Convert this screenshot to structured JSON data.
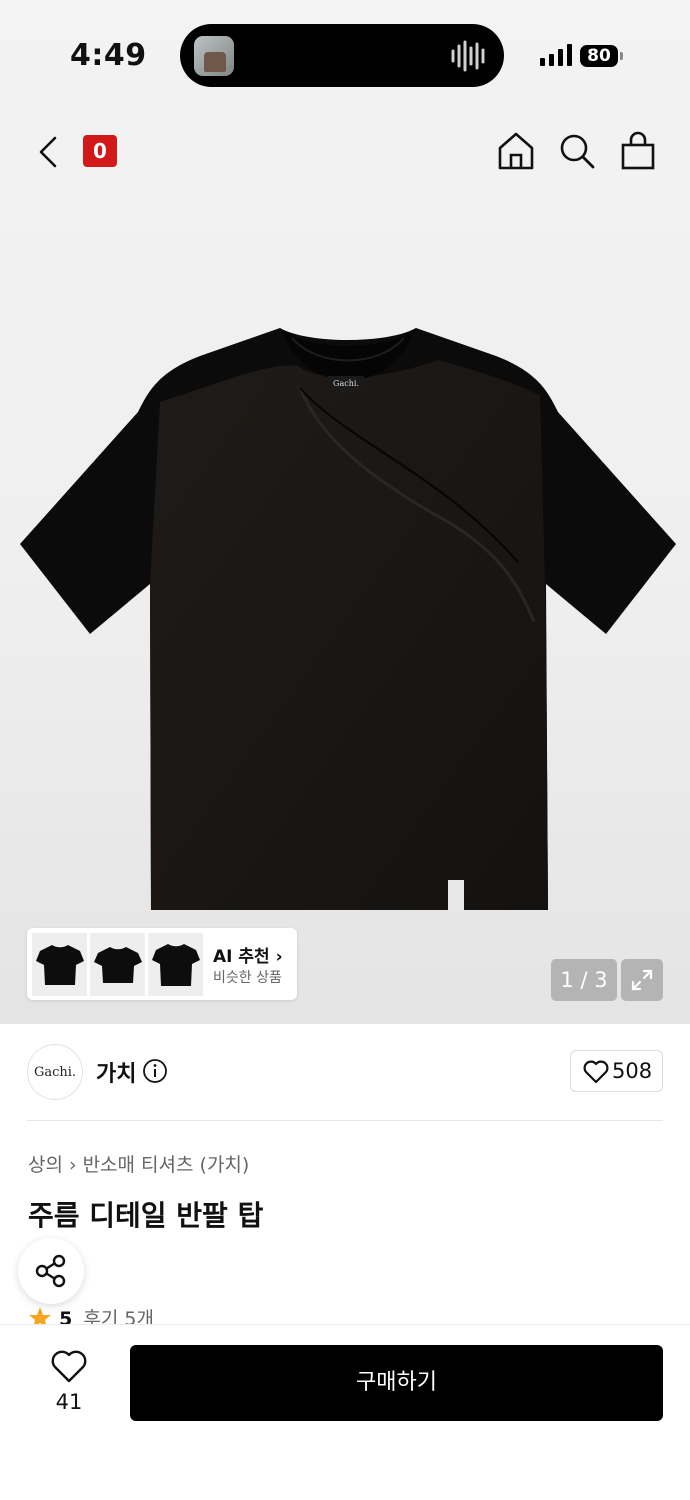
{
  "status_bar": {
    "time": "4:49",
    "battery": "80"
  },
  "nav": {
    "cart_count": "0"
  },
  "gallery": {
    "ai_title": "AI 추천 ›",
    "ai_subtitle": "비슷한 상품",
    "counter": "1 / 3",
    "label_text": "Gachi."
  },
  "brand": {
    "logo_text": "Gachi.",
    "name": "가치",
    "likes": "508"
  },
  "breadcrumb": {
    "category": "상의",
    "subcategory": "반소매 티셔츠 (가치)"
  },
  "product": {
    "title": "주름 디테일 반팔 탑"
  },
  "rating": {
    "score": "5",
    "reviews": "후기 5개"
  },
  "bottom": {
    "wish_count": "41",
    "buy_label": "구매하기"
  },
  "colors": {
    "badge": "#d21919",
    "star": "#f5a623",
    "shirt": "#0e0e0e"
  },
  "icons": [
    "back-icon",
    "home-icon",
    "search-icon",
    "bag-icon",
    "expand-icon",
    "info-icon",
    "heart-icon",
    "share-icon",
    "star-icon"
  ]
}
